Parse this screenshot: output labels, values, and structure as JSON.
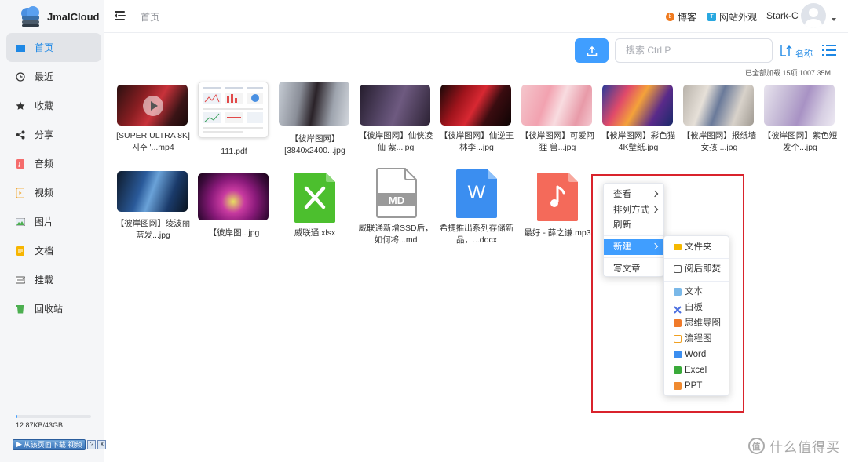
{
  "app": {
    "name": "JmalCloud"
  },
  "sidebar": {
    "items": [
      {
        "label": "首页",
        "icon": "folder-icon"
      },
      {
        "label": "最近",
        "icon": "clock-icon"
      },
      {
        "label": "收藏",
        "icon": "star-icon"
      },
      {
        "label": "分享",
        "icon": "share-icon"
      },
      {
        "label": "音频",
        "icon": "audio-icon"
      },
      {
        "label": "视频",
        "icon": "video-icon"
      },
      {
        "label": "图片",
        "icon": "image-icon"
      },
      {
        "label": "文档",
        "icon": "document-icon"
      },
      {
        "label": "挂载",
        "icon": "mount-icon"
      },
      {
        "label": "回收站",
        "icon": "trash-icon"
      }
    ],
    "active_index": 0,
    "storage": {
      "text": "12.87KB/43GB",
      "fraction": 0.01
    }
  },
  "header": {
    "breadcrumb": "首页",
    "blog_label": "博客",
    "appearance_label": "网站外观",
    "username": "Stark-C"
  },
  "toolbar": {
    "search_placeholder": "搜索 Ctrl P",
    "sort_label": "名称",
    "summary": "已全部加载 15项 1007.35M"
  },
  "files": [
    {
      "name": "[SUPER ULTRA 8K] 지수 '...mp4",
      "type": "video"
    },
    {
      "name": "111.pdf",
      "type": "pdf"
    },
    {
      "name": "【彼岸图网】[3840x2400...jpg",
      "type": "image"
    },
    {
      "name": "【彼岸图网】仙侠凌仙 紫...jpg",
      "type": "image"
    },
    {
      "name": "【彼岸图网】仙逆王林李...jpg",
      "type": "image"
    },
    {
      "name": "【彼岸图网】可爱阿狸 兽...jpg",
      "type": "image"
    },
    {
      "name": "【彼岸图网】彩色猫4K壁纸.jpg",
      "type": "image"
    },
    {
      "name": "【彼岸图网】报纸墙女孩 ...jpg",
      "type": "image"
    },
    {
      "name": "【彼岸图网】紫色短发个...jpg",
      "type": "image"
    },
    {
      "name": "【彼岸图网】绫波丽 蓝发...jpg",
      "type": "image"
    },
    {
      "name": "【彼岸图...jpg",
      "type": "image"
    },
    {
      "name": "威联通.xlsx",
      "type": "excel"
    },
    {
      "name": "威联通新增SSD后，如何将...md",
      "type": "markdown",
      "badge": "MD"
    },
    {
      "name": "希捷推出系列存储新品，...docx",
      "type": "word",
      "badge": "W"
    },
    {
      "name": "最好 - 薛之谦.mp3",
      "type": "audio"
    }
  ],
  "context_menu": {
    "items": [
      "查看",
      "排列方式",
      "刷新",
      "新建",
      "写文章"
    ],
    "hover_index": 3
  },
  "submenu": {
    "folder": "文件夹",
    "burn": "阅后即焚",
    "text": "文本",
    "whiteboard": "白板",
    "mindmap": "思维导图",
    "flowchart": "流程图",
    "word": "Word",
    "excel": "Excel",
    "ppt": "PPT"
  },
  "download_bar": {
    "label": "从该页面下载 视频",
    "help": "?",
    "close": "X"
  },
  "watermark": {
    "logo": "值",
    "text": "什么值得买"
  },
  "colors": {
    "accent": "#409eff",
    "highlight_frame": "#d9232c"
  }
}
